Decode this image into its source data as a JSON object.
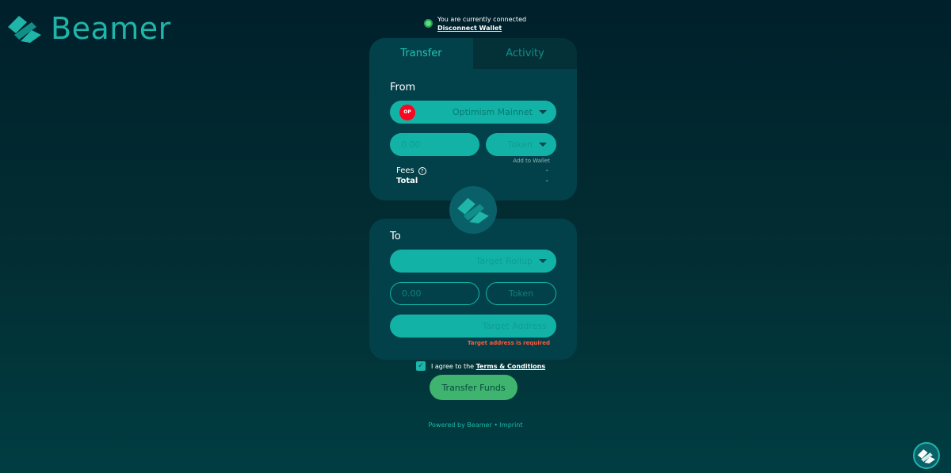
{
  "brand": {
    "name": "Beamer",
    "icon": "beamer-logo-icon",
    "color": "#1fb5a8"
  },
  "connection": {
    "status_text": "You are currently connected",
    "disconnect_label": "Disconnect Wallet",
    "status_color": "#5adf7a"
  },
  "tabs": [
    {
      "label": "Transfer",
      "active": true
    },
    {
      "label": "Activity",
      "active": false
    }
  ],
  "from": {
    "label": "From",
    "network": {
      "name": "Optimism Mainnet",
      "badge": "OP",
      "icon": "optimism-icon"
    },
    "amount_placeholder": "0.00",
    "token_label": "Token",
    "add_to_wallet": "Add to Wallet",
    "fees_label": "Fees",
    "fees_value": "-",
    "total_label": "Total",
    "total_value": "-"
  },
  "to": {
    "label": "To",
    "rollup_placeholder": "Target Rollup",
    "amount_placeholder": "0.00",
    "token_label": "Token",
    "address_placeholder": "Target Address",
    "error": "Target address is required"
  },
  "agree": {
    "prefix": "I agree to the",
    "link": "Terms & Conditions",
    "checked": true
  },
  "transfer_button": "Transfer Funds",
  "footer": {
    "powered": "Powered by Beamer",
    "separator": "•",
    "imprint": "Imprint"
  },
  "colors": {
    "accent": "#12b3a6",
    "card": "#03414a",
    "button": "#3eb46e",
    "error": "#ff5a3c"
  }
}
